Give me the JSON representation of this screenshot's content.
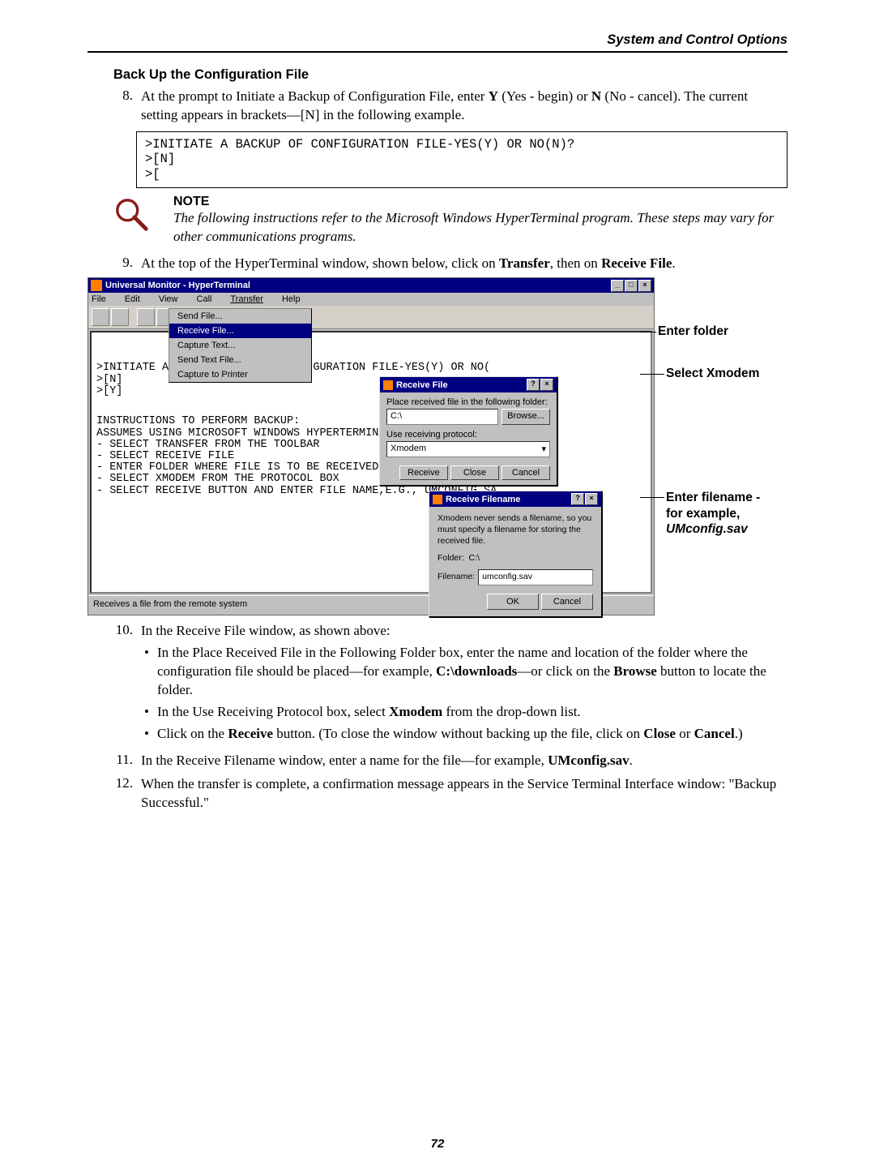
{
  "header": {
    "section": "System and Control Options"
  },
  "title": "Back Up the Configuration File",
  "step8": {
    "num": "8.",
    "text_a": "At the prompt to Initiate a Backup of Configuration File, enter ",
    "y": "Y",
    "text_b": " (Yes - begin) or ",
    "n": "N",
    "text_c": " (No - cancel). The current setting appears in brackets—[N] in the following example."
  },
  "code": ">INITIATE A BACKUP OF CONFIGURATION FILE-YES(Y) OR NO(N)?\n>[N]\n>[",
  "note": {
    "title": "NOTE",
    "body": "The following instructions refer to the Microsoft Windows HyperTerminal program. These steps may vary for other communications programs."
  },
  "step9": {
    "num": "9.",
    "a": "At the top of the HyperTerminal window, shown below, click on ",
    "b": "Transfer",
    "c": ", then on ",
    "d": "Receive File",
    "e": "."
  },
  "fig": {
    "title": "Universal Monitor - HyperTerminal",
    "menu": {
      "file": "File",
      "edit": "Edit",
      "view": "View",
      "call": "Call",
      "transfer": "Transfer",
      "help": "Help"
    },
    "dropdown": [
      "Send File...",
      "Receive File...",
      "Capture Text...",
      "Send Text File...",
      "Capture to Printer"
    ],
    "dropdown_hl_index": 1,
    "term_upper": ">INITIATE A B                   IGURATION FILE-YES(Y) OR NO(\n>[N]\n>[Y]",
    "term_lower": "INSTRUCTIONS TO PERFORM BACKUP:\nASSUMES USING MICROSOFT WINDOWS HYPERTERMINAL APPLICAT\n- SELECT TRANSFER FROM THE TOOLBAR\n- SELECT RECEIVE FILE\n- ENTER FOLDER WHERE FILE IS TO BE RECEIVED\n- SELECT XMODEM FROM THE PROTOCOL BOX\n- SELECT RECEIVE BUTTON AND ENTER FILE NAME,E.G., UMCONFIG.SA",
    "dlg1": {
      "title": "Receive File",
      "lbl_folder": "Place received file in the following folder:",
      "folder_val": "C:\\",
      "browse": "Browse...",
      "lbl_proto": "Use receiving protocol:",
      "proto_val": "Xmodem",
      "btn_receive": "Receive",
      "btn_close": "Close",
      "btn_cancel": "Cancel"
    },
    "dlg2": {
      "title": "Receive Filename",
      "msg": "Xmodem never sends a filename, so you must specify a filename for storing the received file.",
      "folder_lbl": "Folder:",
      "folder_val": "C:\\",
      "fname_lbl": "Filename:",
      "fname_val": "umconfig.sav",
      "ok": "OK",
      "cancel": "Cancel"
    },
    "status": "Receives a file from the remote system"
  },
  "callout": {
    "c1": "Enter folder",
    "c2": "Select Xmodem",
    "c3a": "Enter filename -",
    "c3b": "for example,",
    "c3c": "UMconfig.sav"
  },
  "step10": {
    "num": "10.",
    "lead": "In the Receive File window, as shown above:",
    "b1a": "In the Place Received File in the Following Folder box, enter the name and location of the folder where the configuration file should be placed—for example, ",
    "b1b": "C:\\downloads",
    "b1c": "—or click on the ",
    "b1d": "Browse",
    "b1e": " button to locate the folder.",
    "b2a": "In the Use Receiving Protocol box, select ",
    "b2b": "Xmodem",
    "b2c": " from the drop-down list.",
    "b3a": "Click on the ",
    "b3b": "Receive",
    "b3c": " button. (To close the window without backing up the file, click on ",
    "b3d": "Close",
    "b3e": " or ",
    "b3f": "Cancel",
    "b3g": ".)"
  },
  "step11": {
    "num": "11.",
    "a": "In the Receive Filename window, enter a name for the file—for example, ",
    "b": "UMconfig.sav",
    "c": "."
  },
  "step12": {
    "num": "12.",
    "a": "When the transfer is complete, a confirmation message appears in the Service Terminal Interface window: \"Backup Successful.\""
  },
  "page_number": "72"
}
